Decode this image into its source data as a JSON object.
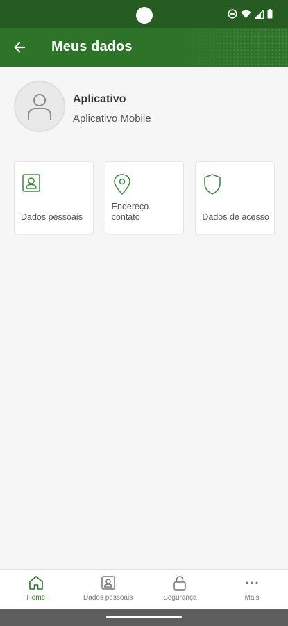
{
  "header": {
    "title": "Meus dados",
    "back_icon": "arrow-left-icon"
  },
  "profile": {
    "name": "Aplicativo",
    "subtitle": "Aplicativo Mobile",
    "avatar_icon": "user-avatar-icon"
  },
  "cards": [
    {
      "label": "Dados pessoais",
      "icon": "id-badge-icon"
    },
    {
      "label": "Endereço contato",
      "icon": "location-pin-icon"
    },
    {
      "label": "Dados de acesso",
      "icon": "shield-icon"
    }
  ],
  "bottom_nav": {
    "items": [
      {
        "label": "Home",
        "icon": "home-icon",
        "active": true
      },
      {
        "label": "Dados pessoais",
        "icon": "id-badge-icon",
        "active": false
      },
      {
        "label": "Segurança",
        "icon": "lock-icon",
        "active": false
      },
      {
        "label": "Mais",
        "icon": "more-horizontal-icon",
        "active": false
      }
    ]
  },
  "colors": {
    "primary": "#2d7429",
    "status_bar": "#265c22",
    "background": "#f6f6f6",
    "icon_green": "#3d8a3a"
  }
}
